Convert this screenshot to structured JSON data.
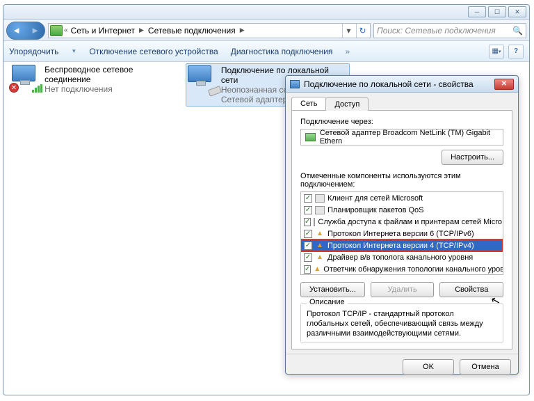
{
  "explorer": {
    "breadcrumb": [
      "Сеть и Интернет",
      "Сетевые подключения"
    ],
    "search_placeholder": "Поиск: Сетевые подключения",
    "toolbar": {
      "organize": "Упорядочить",
      "disable": "Отключение сетевого устройства",
      "diagnose": "Диагностика подключения"
    },
    "items": [
      {
        "name": "Беспроводное сетевое соединение",
        "status": "Нет подключения"
      },
      {
        "name": "Подключение по локальной сети",
        "status": "Неопознанная сеть",
        "sub2": "Сетевой адаптер"
      }
    ]
  },
  "dialog": {
    "title": "Подключение по локальной сети - свойства",
    "tabs": {
      "net": "Сеть",
      "access": "Доступ"
    },
    "connect_via_label": "Подключение через:",
    "adapter": "Сетевой адаптер Broadcom NetLink (TM) Gigabit Ethern",
    "configure": "Настроить...",
    "components_label": "Отмеченные компоненты используются этим подключением:",
    "components": [
      {
        "label": "Клиент для сетей Microsoft",
        "type": "svc"
      },
      {
        "label": "Планировщик пакетов QoS",
        "type": "svc"
      },
      {
        "label": "Служба доступа к файлам и принтерам сетей Micro...",
        "type": "svc"
      },
      {
        "label": "Протокол Интернета версии 6 (TCP/IPv6)",
        "type": "proto"
      },
      {
        "label": "Протокол Интернета версии 4 (TCP/IPv4)",
        "type": "proto",
        "selected": true
      },
      {
        "label": "Драйвер в/в тополога канального уровня",
        "type": "proto"
      },
      {
        "label": "Ответчик обнаружения топологии канального уровня",
        "type": "proto"
      }
    ],
    "buttons": {
      "install": "Установить...",
      "remove": "Удалить",
      "properties": "Свойства"
    },
    "desc_title": "Описание",
    "desc_text": "Протокол TCP/IP - стандартный протокол глобальных сетей, обеспечивающий связь между различными взаимодействующими сетями.",
    "ok": "OK",
    "cancel": "Отмена"
  }
}
